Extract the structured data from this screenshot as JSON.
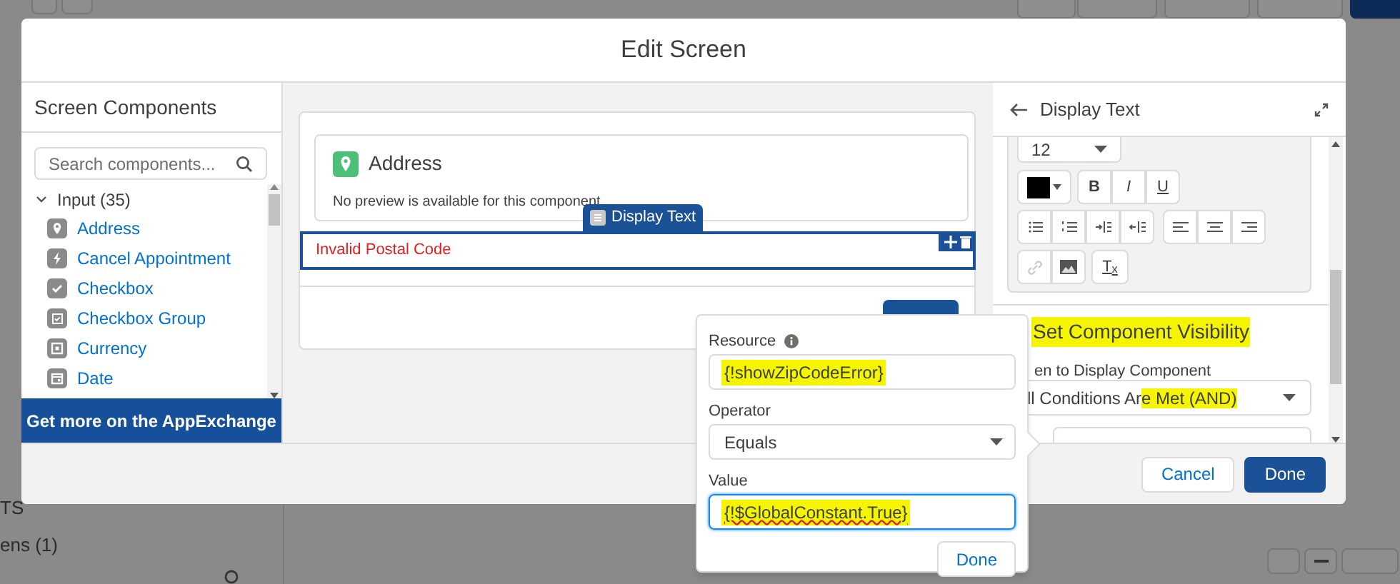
{
  "modal": {
    "title": "Edit Screen"
  },
  "components_panel": {
    "title": "Screen Components",
    "search": {
      "placeholder": "Search components..."
    },
    "group": {
      "label": "Input (35)",
      "expanded": true,
      "items": [
        {
          "label": "Address",
          "kind": "pin"
        },
        {
          "label": "Cancel Appointment",
          "kind": "bolt"
        },
        {
          "label": "Checkbox",
          "kind": "check"
        },
        {
          "label": "Checkbox Group",
          "kind": "group"
        },
        {
          "label": "Currency",
          "kind": "currency"
        },
        {
          "label": "Date",
          "kind": "date"
        }
      ]
    },
    "appexchange_button": "Get more on the AppExchange"
  },
  "canvas": {
    "address_card": {
      "title": "Address",
      "note": "No preview is available for this component."
    },
    "selected_component": {
      "tab_label": "Display Text",
      "text": "Invalid Postal Code"
    }
  },
  "condition_popover": {
    "fields": [
      {
        "kind": "text",
        "label": "Resource",
        "info": true,
        "value": "{!showZipCodeError}",
        "highlighted": true,
        "focused": false,
        "spellcheck_error": false
      },
      {
        "kind": "select",
        "label": "Operator",
        "info": false,
        "value": "Equals",
        "highlighted": false,
        "focused": false,
        "spellcheck_error": false
      },
      {
        "kind": "text",
        "label": "Value",
        "info": false,
        "value": "{!$GlobalConstant.True}",
        "highlighted": true,
        "focused": true,
        "spellcheck_error": true
      }
    ],
    "done": "Done"
  },
  "properties_panel": {
    "title": "Display Text",
    "font_size": "12",
    "format_buttons": [
      "B",
      "I",
      "U"
    ],
    "clear_format": "T$_{x}$",
    "section_title": "Set Component Visibility",
    "section_highlighted": true,
    "visibility_label": "en to Display Component",
    "visibility_select": [
      {
        "text": "ll Conditions Ar",
        "highlighted": false
      },
      {
        "text": "e Met (AND)",
        "highlighted": true
      }
    ]
  },
  "footer": {
    "buttons": [
      {
        "label": "Cancel",
        "kind": "neutral"
      },
      {
        "label": "Done",
        "kind": "brand"
      }
    ]
  },
  "background": {
    "sidebar": [
      "TS",
      "ens (1)"
    ]
  }
}
